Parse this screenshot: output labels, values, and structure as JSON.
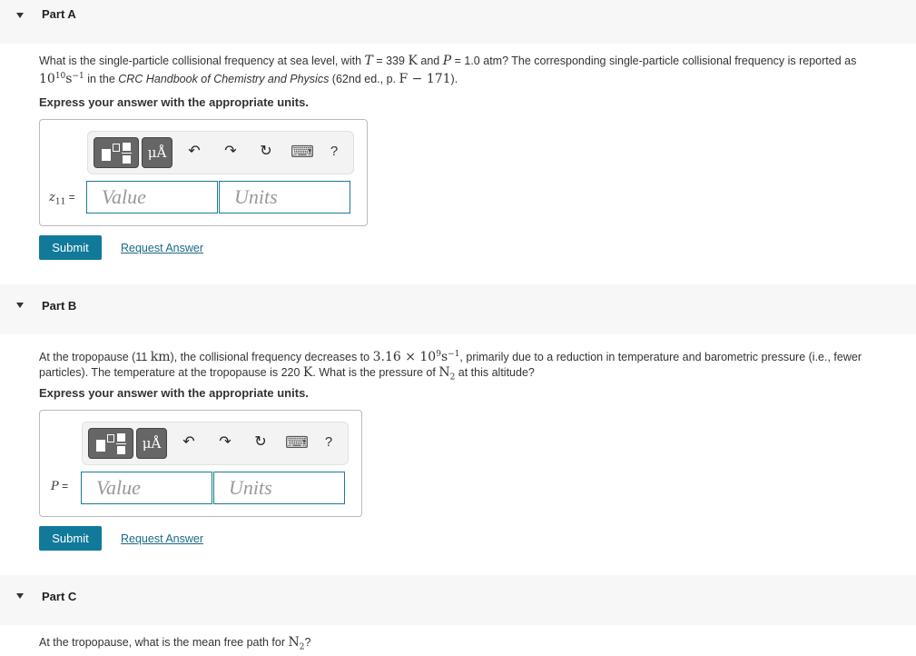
{
  "parts": [
    {
      "label": "Part A",
      "question": {
        "t1": "What is the single-particle collisional frequency at sea level, with ",
        "T": "T",
        "eq1": " = 339 ",
        "K": "K",
        "t2": " and ",
        "P": "P",
        "eq2": " = 1.0 atm? The corresponding single-particle collisional frequency is reported as",
        "base": "10",
        "exp": "10",
        "unit": "s",
        "uexp": "−1",
        "t3": " in the ",
        "book": "CRC Handbook of Chemistry and Physics",
        "t4": " (62nd ed., p. ",
        "page": "F − 171",
        "t5": ")."
      },
      "express": "Express your answer with the appropriate units.",
      "var_label": "z",
      "var_sub": "11",
      "eq_sign": " =",
      "value_placeholder": "Value",
      "units_placeholder": "Units",
      "submit": "Submit",
      "request": "Request Answer"
    },
    {
      "label": "Part B",
      "question": {
        "t1": "At the tropopause (11 ",
        "km": "km",
        "t2": "), the collisional frequency decreases to ",
        "freq": "3.16 × 10",
        "exp": "9",
        "unit": "s",
        "uexp": "−1",
        "t3": ", primarily due to a reduction in temperature and barometric pressure (i.e., fewer particles). The temperature at the tropopause is 220 ",
        "K": "K",
        "t4": ". What is the pressure of ",
        "N": "N",
        "Nsub": "2",
        "t5": " at this altitude?"
      },
      "express": "Express your answer with the appropriate units.",
      "var_label": "P",
      "eq_sign": " =",
      "value_placeholder": "Value",
      "units_placeholder": "Units",
      "submit": "Submit",
      "request": "Request Answer"
    },
    {
      "label": "Part C",
      "question": {
        "t1": "At the tropopause, what is the mean free path for ",
        "N": "N",
        "Nsub": "2",
        "t2": "?"
      }
    }
  ],
  "toolbar": {
    "units_symbol": "μÅ",
    "undo": "↶",
    "redo": "↷",
    "reset": "↻",
    "keyboard": "⌨",
    "help": "?"
  }
}
